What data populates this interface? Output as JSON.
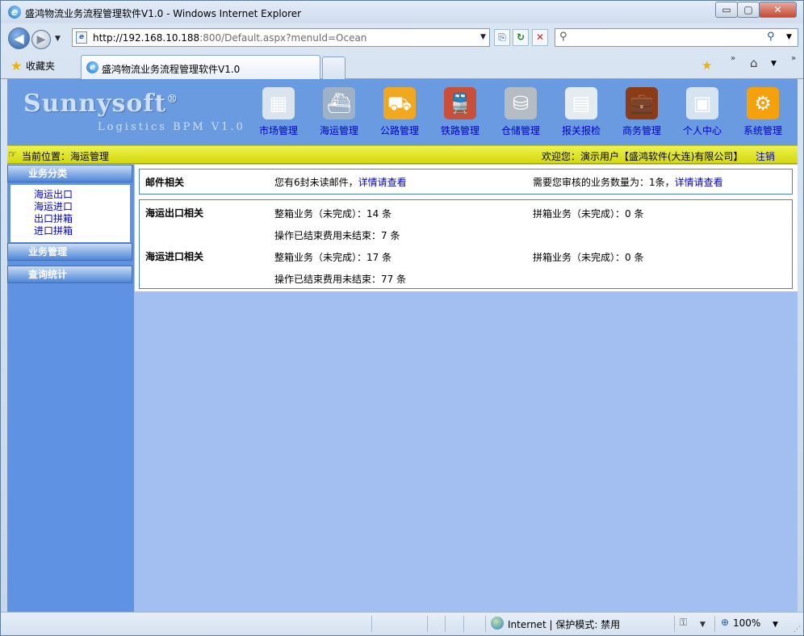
{
  "window": {
    "title": "盛鸿物流业务流程管理软件V1.0 - Windows Internet Explorer",
    "min_symbol": "▭",
    "max_symbol": "▢",
    "close_symbol": "✕"
  },
  "nav": {
    "back_symbol": "◀",
    "forward_symbol": "▶",
    "dropdown_symbol": "▼",
    "url_host": "http://192.168.10.188",
    "url_path": ":800/Default.aspx?menuId=Ocean",
    "compat_symbol": "⎘",
    "refresh_symbol": "↻",
    "stop_symbol": "✕",
    "search_symbol": "⚲",
    "search_go_symbol": "⚲"
  },
  "tabbar": {
    "favorites_label": "收藏夹",
    "tab_label": "盛鸿物流业务流程管理软件V1.0",
    "chevron": "»",
    "add_fav_symbol": "★",
    "home_symbol": "⌂"
  },
  "app": {
    "logo_main": "Sunnysoft",
    "logo_reg": "®",
    "logo_sub": "Logistics BPM V1.0",
    "modules": [
      {
        "label": "市场管理",
        "icon": "market-icon",
        "glyph": "▦",
        "color": "#d9e4ee"
      },
      {
        "label": "海运管理",
        "icon": "ship-icon",
        "glyph": "⛴",
        "color": "#9fb1c6"
      },
      {
        "label": "公路管理",
        "icon": "truck-icon",
        "glyph": "⛟",
        "color": "#f0a820"
      },
      {
        "label": "铁路管理",
        "icon": "train-icon",
        "glyph": "🚆",
        "color": "#c8503a"
      },
      {
        "label": "仓储管理",
        "icon": "database-icon",
        "glyph": "⛁",
        "color": "#b5bcc4"
      },
      {
        "label": "报关报检",
        "icon": "document-icon",
        "glyph": "▤",
        "color": "#e4ecf2"
      },
      {
        "label": "商务管理",
        "icon": "briefcase-icon",
        "glyph": "💼",
        "color": "#8b3c16"
      },
      {
        "label": "个人中心",
        "icon": "idcard-icon",
        "glyph": "▣",
        "color": "#d6e4f1"
      },
      {
        "label": "系统管理",
        "icon": "gear-icon",
        "glyph": "⚙",
        "color": "#f5a10b"
      }
    ],
    "location": {
      "hand_symbol": "☞",
      "text": "当前位置：海运管理",
      "welcome": "欢迎您：演示用户【盛鸿软件(大连)有限公司】",
      "logout": "注销"
    },
    "sidebar": {
      "section1": "业务分类",
      "items": [
        "海运出口",
        "海运进口",
        "出口拼箱",
        "进口拼箱"
      ],
      "section2": "业务管理",
      "section3": "查询统计"
    },
    "mail_panel": {
      "title": "邮件相关",
      "unread_prefix": "您有6封未读邮件，",
      "unread_link": "详情请查看",
      "review_prefix": "需要您审核的业务数量为：1条，",
      "review_link": "详情请查看"
    },
    "ocean_panel": {
      "export_title": "海运出口相关",
      "export_full": "整箱业务（未完成）：14 条",
      "export_lcl": "拼箱业务（未完成）：0 条",
      "export_fee": "操作已结束费用未结束：7 条",
      "import_title": "海运进口相关",
      "import_full": "整箱业务（未完成）：17 条",
      "import_lcl": "拼箱业务（未完成）：0 条",
      "import_fee": "操作已结束费用未结束：77 条"
    }
  },
  "status": {
    "zone": "Internet | 保护模式: 禁用",
    "zoom": "100%",
    "zoom_symbol": "⊕",
    "lock_symbol": "⚿",
    "grip": "⋰"
  }
}
